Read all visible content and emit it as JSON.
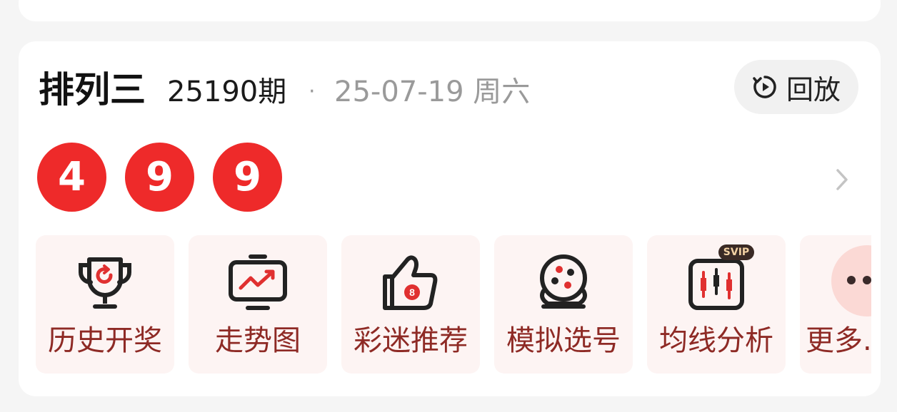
{
  "lottery": {
    "name": "排列三",
    "issue": "25190期",
    "separator": "·",
    "date": "25-07-19 周六",
    "replay_label": "回放",
    "numbers": [
      "4",
      "9",
      "9"
    ]
  },
  "tools": [
    {
      "label": "历史开奖",
      "icon": "trophy-icon"
    },
    {
      "label": "走势图",
      "icon": "trend-chart-icon"
    },
    {
      "label": "彩迷推荐",
      "icon": "thumbs-up-icon"
    },
    {
      "label": "模拟选号",
      "icon": "lottery-ball-machine-icon"
    },
    {
      "label": "均线分析",
      "icon": "candlestick-chart-icon",
      "badge": "SVIP"
    },
    {
      "label": "更多.",
      "icon": "more-dots-icon"
    }
  ],
  "colors": {
    "ball": "#ee2a2a",
    "tool_bg": "#fdf4f3",
    "tool_label": "#8e2a25",
    "icon_accent": "#e03030"
  }
}
